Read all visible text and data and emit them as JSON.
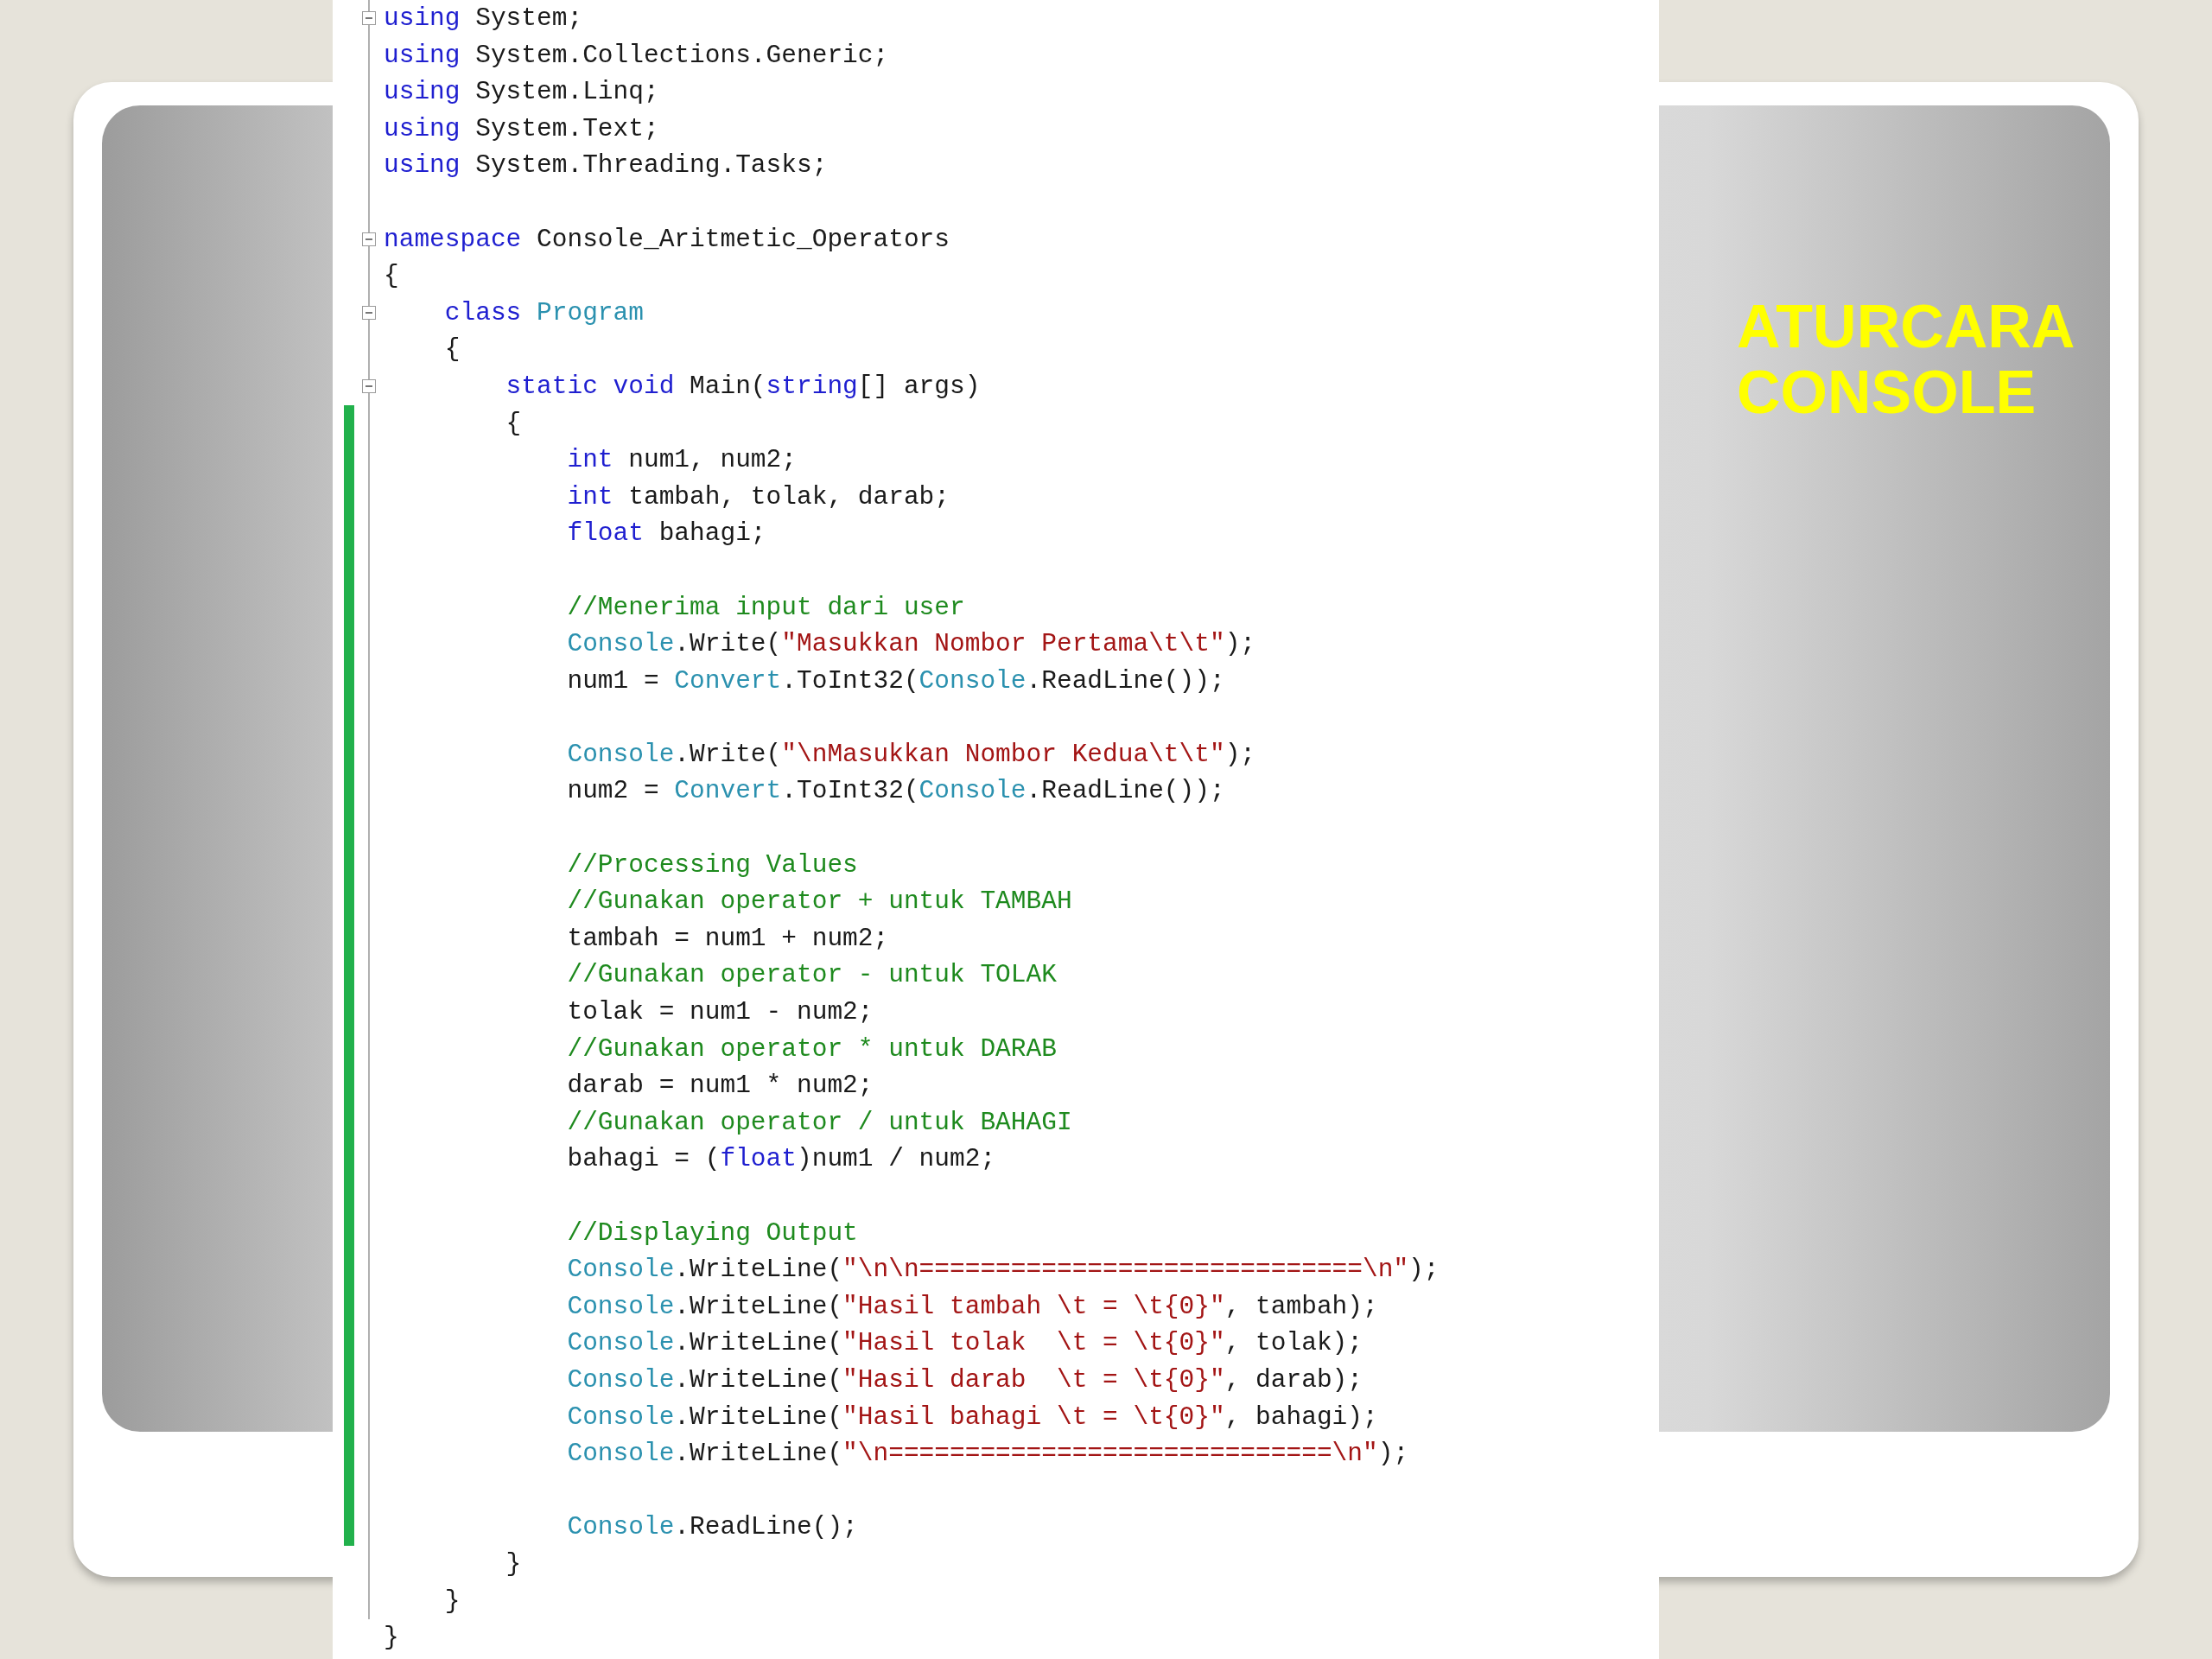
{
  "slide": {
    "title": "ATURCARA CONSOLE"
  },
  "editor": {
    "lines": [
      {
        "fold": true,
        "changed": false,
        "tokens": [
          {
            "kind": "keyword",
            "text": "using"
          },
          {
            "kind": "plain",
            "text": " System;"
          }
        ]
      },
      {
        "fold": false,
        "changed": false,
        "tokens": [
          {
            "kind": "keyword",
            "text": "using"
          },
          {
            "kind": "plain",
            "text": " System.Collections.Generic;"
          }
        ]
      },
      {
        "fold": false,
        "changed": false,
        "tokens": [
          {
            "kind": "keyword",
            "text": "using"
          },
          {
            "kind": "plain",
            "text": " System.Linq;"
          }
        ]
      },
      {
        "fold": false,
        "changed": false,
        "tokens": [
          {
            "kind": "keyword",
            "text": "using"
          },
          {
            "kind": "plain",
            "text": " System.Text;"
          }
        ]
      },
      {
        "fold": false,
        "changed": false,
        "tokens": [
          {
            "kind": "keyword",
            "text": "using"
          },
          {
            "kind": "plain",
            "text": " System.Threading.Tasks;"
          }
        ]
      },
      {
        "fold": false,
        "changed": false
      },
      {
        "fold": true,
        "changed": false,
        "tokens": [
          {
            "kind": "keyword",
            "text": "namespace"
          },
          {
            "kind": "plain",
            "text": " Console_Aritmetic_Operators"
          }
        ]
      },
      {
        "fold": false,
        "changed": false,
        "tokens": [
          {
            "kind": "plain",
            "text": "{"
          }
        ]
      },
      {
        "fold": true,
        "changed": false,
        "tokens": [
          {
            "kind": "keyword",
            "text": "    class "
          },
          {
            "kind": "type",
            "text": "Program"
          }
        ]
      },
      {
        "fold": false,
        "changed": false,
        "tokens": [
          {
            "kind": "plain",
            "text": "    {"
          }
        ]
      },
      {
        "fold": true,
        "changed": false,
        "tokens": [
          {
            "kind": "keyword",
            "text": "        static void"
          },
          {
            "kind": "plain",
            "text": " Main("
          },
          {
            "kind": "keyword",
            "text": "string"
          },
          {
            "kind": "plain",
            "text": "[] args)"
          }
        ]
      },
      {
        "fold": false,
        "changed": true,
        "tokens": [
          {
            "kind": "plain",
            "text": "        {"
          }
        ]
      },
      {
        "fold": false,
        "changed": true,
        "tokens": [
          {
            "kind": "keyword",
            "text": "            int"
          },
          {
            "kind": "plain",
            "text": " num1, num2;"
          }
        ]
      },
      {
        "fold": false,
        "changed": true,
        "tokens": [
          {
            "kind": "keyword",
            "text": "            int"
          },
          {
            "kind": "plain",
            "text": " tambah, tolak, darab;"
          }
        ]
      },
      {
        "fold": false,
        "changed": true,
        "tokens": [
          {
            "kind": "keyword",
            "text": "            float"
          },
          {
            "kind": "plain",
            "text": " bahagi;"
          }
        ]
      },
      {
        "fold": false,
        "changed": true
      },
      {
        "fold": false,
        "changed": true,
        "tokens": [
          {
            "kind": "comment",
            "text": "            //Menerima input dari user"
          }
        ]
      },
      {
        "fold": false,
        "changed": true,
        "tokens": [
          {
            "kind": "type",
            "text": "            Console"
          },
          {
            "kind": "plain",
            "text": ".Write("
          },
          {
            "kind": "string",
            "text": "\"Masukkan Nombor Pertama\\t\\t\""
          },
          {
            "kind": "plain",
            "text": ");"
          }
        ]
      },
      {
        "fold": false,
        "changed": true,
        "tokens": [
          {
            "kind": "plain",
            "text": "            num1 = "
          },
          {
            "kind": "type",
            "text": "Convert"
          },
          {
            "kind": "plain",
            "text": ".ToInt32("
          },
          {
            "kind": "type",
            "text": "Console"
          },
          {
            "kind": "plain",
            "text": ".ReadLine());"
          }
        ]
      },
      {
        "fold": false,
        "changed": true
      },
      {
        "fold": false,
        "changed": true,
        "tokens": [
          {
            "kind": "type",
            "text": "            Console"
          },
          {
            "kind": "plain",
            "text": ".Write("
          },
          {
            "kind": "string",
            "text": "\"\\nMasukkan Nombor Kedua\\t\\t\""
          },
          {
            "kind": "plain",
            "text": ");"
          }
        ]
      },
      {
        "fold": false,
        "changed": true,
        "tokens": [
          {
            "kind": "plain",
            "text": "            num2 = "
          },
          {
            "kind": "type",
            "text": "Convert"
          },
          {
            "kind": "plain",
            "text": ".ToInt32("
          },
          {
            "kind": "type",
            "text": "Console"
          },
          {
            "kind": "plain",
            "text": ".ReadLine());"
          }
        ]
      },
      {
        "fold": false,
        "changed": true
      },
      {
        "fold": false,
        "changed": true,
        "tokens": [
          {
            "kind": "comment",
            "text": "            //Processing Values"
          }
        ]
      },
      {
        "fold": false,
        "changed": true,
        "tokens": [
          {
            "kind": "comment",
            "text": "            //Gunakan operator + untuk TAMBAH"
          }
        ]
      },
      {
        "fold": false,
        "changed": true,
        "tokens": [
          {
            "kind": "plain",
            "text": "            tambah = num1 + num2;"
          }
        ]
      },
      {
        "fold": false,
        "changed": true,
        "tokens": [
          {
            "kind": "comment",
            "text": "            //Gunakan operator - untuk TOLAK"
          }
        ]
      },
      {
        "fold": false,
        "changed": true,
        "tokens": [
          {
            "kind": "plain",
            "text": "            tolak = num1 - num2;"
          }
        ]
      },
      {
        "fold": false,
        "changed": true,
        "tokens": [
          {
            "kind": "comment",
            "text": "            //Gunakan operator * untuk DARAB"
          }
        ]
      },
      {
        "fold": false,
        "changed": true,
        "tokens": [
          {
            "kind": "plain",
            "text": "            darab = num1 * num2;"
          }
        ]
      },
      {
        "fold": false,
        "changed": true,
        "tokens": [
          {
            "kind": "comment",
            "text": "            //Gunakan operator / untuk BAHAGI"
          }
        ]
      },
      {
        "fold": false,
        "changed": true,
        "tokens": [
          {
            "kind": "plain",
            "text": "            bahagi = ("
          },
          {
            "kind": "keyword",
            "text": "float"
          },
          {
            "kind": "plain",
            "text": ")num1 / num2;"
          }
        ]
      },
      {
        "fold": false,
        "changed": true
      },
      {
        "fold": false,
        "changed": true,
        "tokens": [
          {
            "kind": "comment",
            "text": "            //Displaying Output"
          }
        ]
      },
      {
        "fold": false,
        "changed": true,
        "tokens": [
          {
            "kind": "type",
            "text": "            Console"
          },
          {
            "kind": "plain",
            "text": ".WriteLine("
          },
          {
            "kind": "string",
            "text": "\"\\n\\n=============================\\n\""
          },
          {
            "kind": "plain",
            "text": ");"
          }
        ]
      },
      {
        "fold": false,
        "changed": true,
        "tokens": [
          {
            "kind": "type",
            "text": "            Console"
          },
          {
            "kind": "plain",
            "text": ".WriteLine("
          },
          {
            "kind": "string",
            "text": "\"Hasil tambah \\t = \\t{0}\""
          },
          {
            "kind": "plain",
            "text": ", tambah);"
          }
        ]
      },
      {
        "fold": false,
        "changed": true,
        "tokens": [
          {
            "kind": "type",
            "text": "            Console"
          },
          {
            "kind": "plain",
            "text": ".WriteLine("
          },
          {
            "kind": "string",
            "text": "\"Hasil tolak  \\t = \\t{0}\""
          },
          {
            "kind": "plain",
            "text": ", tolak);"
          }
        ]
      },
      {
        "fold": false,
        "changed": true,
        "tokens": [
          {
            "kind": "type",
            "text": "            Console"
          },
          {
            "kind": "plain",
            "text": ".WriteLine("
          },
          {
            "kind": "string",
            "text": "\"Hasil darab  \\t = \\t{0}\""
          },
          {
            "kind": "plain",
            "text": ", darab);"
          }
        ]
      },
      {
        "fold": false,
        "changed": true,
        "tokens": [
          {
            "kind": "type",
            "text": "            Console"
          },
          {
            "kind": "plain",
            "text": ".WriteLine("
          },
          {
            "kind": "string",
            "text": "\"Hasil bahagi \\t = \\t{0}\""
          },
          {
            "kind": "plain",
            "text": ", bahagi);"
          }
        ]
      },
      {
        "fold": false,
        "changed": true,
        "tokens": [
          {
            "kind": "type",
            "text": "            Console"
          },
          {
            "kind": "plain",
            "text": ".WriteLine("
          },
          {
            "kind": "string",
            "text": "\"\\n=============================\\n\""
          },
          {
            "kind": "plain",
            "text": ");"
          }
        ]
      },
      {
        "fold": false,
        "changed": true
      },
      {
        "fold": false,
        "changed": true,
        "tokens": [
          {
            "kind": "type",
            "text": "            Console"
          },
          {
            "kind": "plain",
            "text": ".ReadLine();"
          }
        ]
      },
      {
        "fold": false,
        "changed": false,
        "tokens": [
          {
            "kind": "plain",
            "text": "        }"
          }
        ]
      },
      {
        "fold": false,
        "changed": false,
        "tokens": [
          {
            "kind": "plain",
            "text": "    }"
          }
        ]
      },
      {
        "fold": false,
        "changed": false,
        "tokens": [
          {
            "kind": "plain",
            "text": "}"
          }
        ]
      }
    ]
  }
}
